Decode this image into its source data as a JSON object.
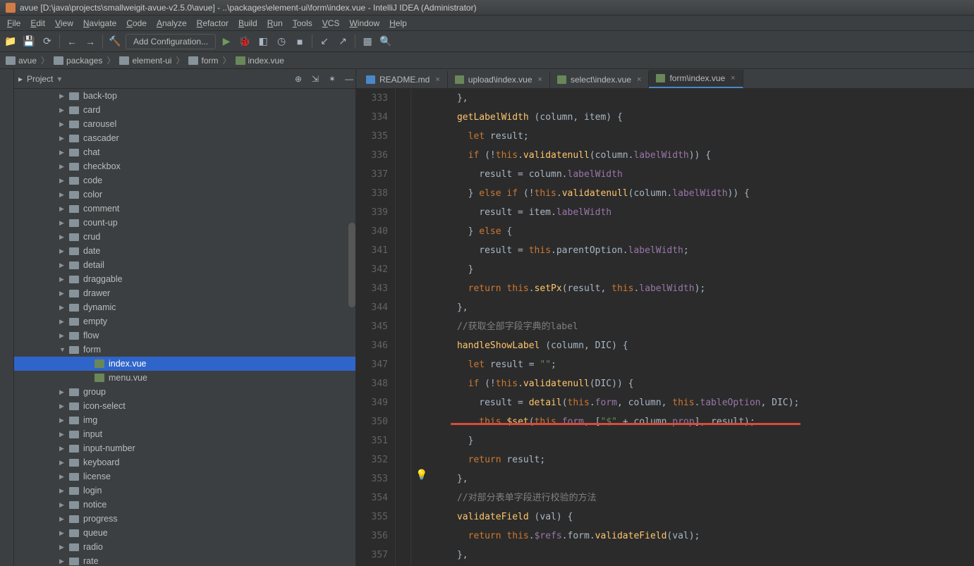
{
  "title": "avue [D:\\java\\projects\\smallweigit-avue-v2.5.0\\avue] - ..\\packages\\element-ui\\form\\index.vue - IntelliJ IDEA (Administrator)",
  "menus": [
    "File",
    "Edit",
    "View",
    "Navigate",
    "Code",
    "Analyze",
    "Refactor",
    "Build",
    "Run",
    "Tools",
    "VCS",
    "Window",
    "Help"
  ],
  "addConfig": "Add Configuration...",
  "breadcrumb": [
    "avue",
    "packages",
    "element-ui",
    "form",
    "index.vue"
  ],
  "project": {
    "label": "Project"
  },
  "tree": [
    {
      "t": "folder",
      "name": "back-top"
    },
    {
      "t": "folder",
      "name": "card"
    },
    {
      "t": "folder",
      "name": "carousel"
    },
    {
      "t": "folder",
      "name": "cascader"
    },
    {
      "t": "folder",
      "name": "chat"
    },
    {
      "t": "folder",
      "name": "checkbox"
    },
    {
      "t": "folder",
      "name": "code"
    },
    {
      "t": "folder",
      "name": "color"
    },
    {
      "t": "folder",
      "name": "comment"
    },
    {
      "t": "folder",
      "name": "count-up"
    },
    {
      "t": "folder",
      "name": "crud"
    },
    {
      "t": "folder",
      "name": "date"
    },
    {
      "t": "folder",
      "name": "detail"
    },
    {
      "t": "folder",
      "name": "draggable"
    },
    {
      "t": "folder",
      "name": "drawer"
    },
    {
      "t": "folder",
      "name": "dynamic"
    },
    {
      "t": "folder",
      "name": "empty"
    },
    {
      "t": "folder",
      "name": "flow"
    },
    {
      "t": "folder",
      "name": "form",
      "open": true,
      "children": [
        {
          "t": "file",
          "name": "index.vue",
          "selected": true
        },
        {
          "t": "file",
          "name": "menu.vue"
        }
      ]
    },
    {
      "t": "folder",
      "name": "group"
    },
    {
      "t": "folder",
      "name": "icon-select"
    },
    {
      "t": "folder",
      "name": "img"
    },
    {
      "t": "folder",
      "name": "input"
    },
    {
      "t": "folder",
      "name": "input-number"
    },
    {
      "t": "folder",
      "name": "keyboard"
    },
    {
      "t": "folder",
      "name": "license"
    },
    {
      "t": "folder",
      "name": "login"
    },
    {
      "t": "folder",
      "name": "notice"
    },
    {
      "t": "folder",
      "name": "progress"
    },
    {
      "t": "folder",
      "name": "queue"
    },
    {
      "t": "folder",
      "name": "radio"
    },
    {
      "t": "folder",
      "name": "rate"
    }
  ],
  "tabs": [
    {
      "label": "README.md",
      "type": "md"
    },
    {
      "label": "upload\\index.vue",
      "type": "vue"
    },
    {
      "label": "select\\index.vue",
      "type": "vue"
    },
    {
      "label": "form\\index.vue",
      "type": "vue",
      "active": true
    }
  ],
  "lineStart": 333,
  "lineEnd": 357,
  "code": {
    "l333": "      },",
    "l334a": "      ",
    "l334b": "getLabelWidth",
    "l334c": " (column, item) {",
    "l335a": "        ",
    "l335b": "let",
    "l335c": " result;",
    "l336a": "        ",
    "l336b": "if",
    "l336c": " (!",
    "l336d": "this",
    "l336e": ".",
    "l336f": "validatenull",
    "l336g": "(column.",
    "l336h": "labelWidth",
    "l336i": ")) {",
    "l337a": "          result = column.",
    "l337b": "labelWidth",
    "l338a": "        } ",
    "l338b": "else if",
    "l338c": " (!",
    "l338d": "this",
    "l338e": ".",
    "l338f": "validatenull",
    "l338g": "(column.",
    "l338h": "labelWidth",
    "l338i": ")) {",
    "l339a": "          result = item.",
    "l339b": "labelWidth",
    "l340a": "        } ",
    "l340b": "else",
    "l340c": " {",
    "l341a": "          result = ",
    "l341b": "this",
    "l341c": ".parentOption.",
    "l341d": "labelWidth",
    "l341e": ";",
    "l342": "        }",
    "l343a": "        ",
    "l343b": "return ",
    "l343c": "this",
    "l343d": ".",
    "l343e": "setPx",
    "l343f": "(result, ",
    "l343g": "this",
    "l343h": ".",
    "l343i": "labelWidth",
    "l343j": ");",
    "l344": "      },",
    "l345": "      //获取全部字段字典的label",
    "l346a": "      ",
    "l346b": "handleShowLabel",
    "l346c": " (column, DIC) {",
    "l347a": "        ",
    "l347b": "let",
    "l347c": " result = ",
    "l347d": "\"\"",
    "l347e": ";",
    "l348a": "        ",
    "l348b": "if",
    "l348c": " (!",
    "l348d": "this",
    "l348e": ".",
    "l348f": "validatenull",
    "l348g": "(DIC)) {",
    "l349a": "          result = ",
    "l349b": "detail",
    "l349c": "(",
    "l349d": "this",
    "l349e": ".",
    "l349f": "form",
    "l349g": ", column, ",
    "l349h": "this",
    "l349i": ".",
    "l349j": "tableOption",
    "l349k": ", DIC);",
    "l350a": "          ",
    "l350b": "this",
    "l350c": ".",
    "l350d": "$set",
    "l350e": "(",
    "l350f": "this",
    "l350g": ".",
    "l350h": "form",
    "l350i": ", [",
    "l350j": "\"$\"",
    "l350k": " + column.",
    "l350l": "prop",
    "l350m": "], result);",
    "l351": "        }",
    "l352a": "        ",
    "l352b": "return",
    "l352c": " result;",
    "l353": "      },",
    "l354": "      //对部分表单字段进行校验的方法",
    "l355a": "      ",
    "l355b": "validateField",
    "l355c": " (val) {",
    "l356a": "        ",
    "l356b": "return ",
    "l356c": "this",
    "l356d": ".",
    "l356e": "$refs",
    "l356f": ".form.",
    "l356g": "validateField",
    "l356h": "(val);",
    "l357": "      },"
  }
}
